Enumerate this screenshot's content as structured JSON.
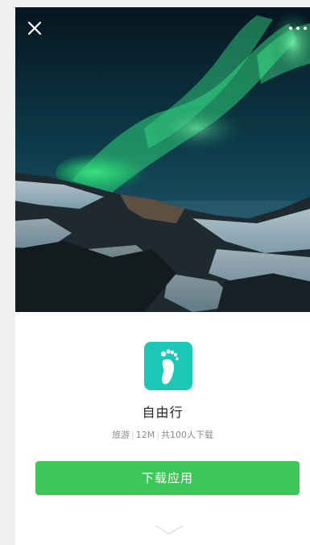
{
  "hero": {
    "image_subject": "aurora-borealis-over-snowy-mountains"
  },
  "toolbar": {
    "close_icon": "close-icon",
    "more_icon": "more-dots-icon"
  },
  "app": {
    "icon": "footprint-icon",
    "icon_color": "#1cc7b5",
    "name": "自由行",
    "category": "旅游",
    "size": "12M",
    "downloads": "共100人下载",
    "download_button_label": "下载应用",
    "button_color": "#3dc65a"
  },
  "footer": {
    "expand_icon": "chevron-down-icon"
  }
}
